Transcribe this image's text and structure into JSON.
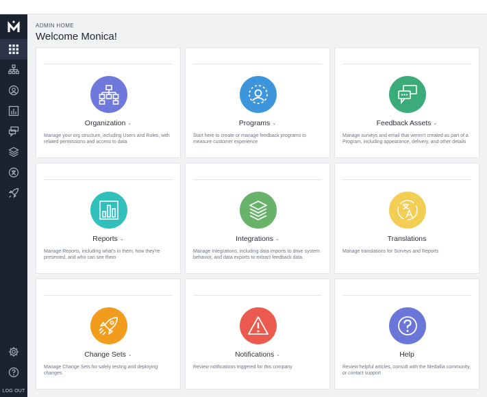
{
  "header": {
    "eyebrow": "ADMIN HOME",
    "welcome": "Welcome Monica!"
  },
  "sidebar": {
    "logo_letter": "M",
    "items": [
      {
        "name": "apps-grid-icon",
        "active": true
      },
      {
        "name": "org-chart-icon"
      },
      {
        "name": "program-icon"
      },
      {
        "name": "reports-icon"
      },
      {
        "name": "assets-icon"
      },
      {
        "name": "layers-icon"
      },
      {
        "name": "translation-icon"
      },
      {
        "name": "rocket-icon"
      }
    ],
    "logout_label": "LOG OUT"
  },
  "colors": {
    "organization": "#6f79db",
    "programs": "#3d95dc",
    "feedback_assets": "#3aab79",
    "reports": "#31c0bb",
    "integrations": "#68b36a",
    "translations": "#f3ce55",
    "change_sets": "#f19c1d",
    "notifications": "#ea5a4e",
    "help": "#6a76d8"
  },
  "cards": [
    {
      "title": "Organization",
      "has_chevron": true,
      "desc": "Manage your org structure, including Users and Roles, with related permissions and access to data"
    },
    {
      "title": "Programs",
      "has_chevron": true,
      "desc": "Start here to create or manage feedback programs to measure customer experience"
    },
    {
      "title": "Feedback Assets",
      "has_chevron": true,
      "desc": "Manage surveys and email that weren't created as part of a Program, including appearance, delivery, and other details"
    },
    {
      "title": "Reports",
      "has_chevron": true,
      "desc": "Manage Reports, including what's in them, how they're presented, and who can see them"
    },
    {
      "title": "Integrations",
      "has_chevron": true,
      "desc": "Manage Integrations, including data imports to drive system behavior, and data exports to extract feedback data."
    },
    {
      "title": "Translations",
      "has_chevron": false,
      "desc": "Manage translations for Surveys and Reports"
    },
    {
      "title": "Change Sets",
      "has_chevron": true,
      "desc": "Manage Change Sets for safely testing and deploying changes"
    },
    {
      "title": "Notifications",
      "has_chevron": true,
      "desc": "Review notifications triggered for this company"
    },
    {
      "title": "Help",
      "has_chevron": false,
      "desc": "Review helpful articles, consult with the Medallia community, or contact support"
    }
  ],
  "icons": {
    "chevron": "⌄"
  }
}
